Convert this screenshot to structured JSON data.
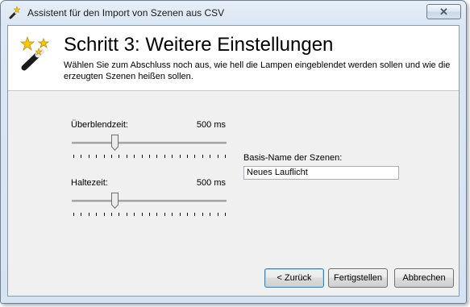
{
  "window": {
    "title": "Assistent für den Import von Szenen aus CSV"
  },
  "header": {
    "title": "Schritt 3: Weitere Einstellungen",
    "description": "Wählen Sie zum Abschluss noch aus, wie hell die Lampen eingeblendet werden sollen und wie die erzeugten Szenen heißen sollen."
  },
  "settings": {
    "crossfade": {
      "label": "Überblendzeit:",
      "value_text": "500 ms",
      "position_fraction": 0.27,
      "tick_count": 21
    },
    "hold": {
      "label": "Haltezeit:",
      "value_text": "500 ms",
      "position_fraction": 0.27,
      "tick_count": 21
    },
    "base_name": {
      "label": "Basis-Name der Szenen:",
      "value": "Neues Lauflicht"
    }
  },
  "buttons": {
    "back": "< Zurück",
    "finish": "Fertigstellen",
    "cancel": "Abbrechen"
  },
  "colors": {
    "window_frame": "#dbe7f4",
    "client_background": "#f0f0f0",
    "header_background": "#ffffff",
    "default_button_border": "#3c7fb1"
  },
  "icons": {
    "title": "magic-wand-icon",
    "header": "magic-wand-stars-icon",
    "close": "close-icon"
  }
}
